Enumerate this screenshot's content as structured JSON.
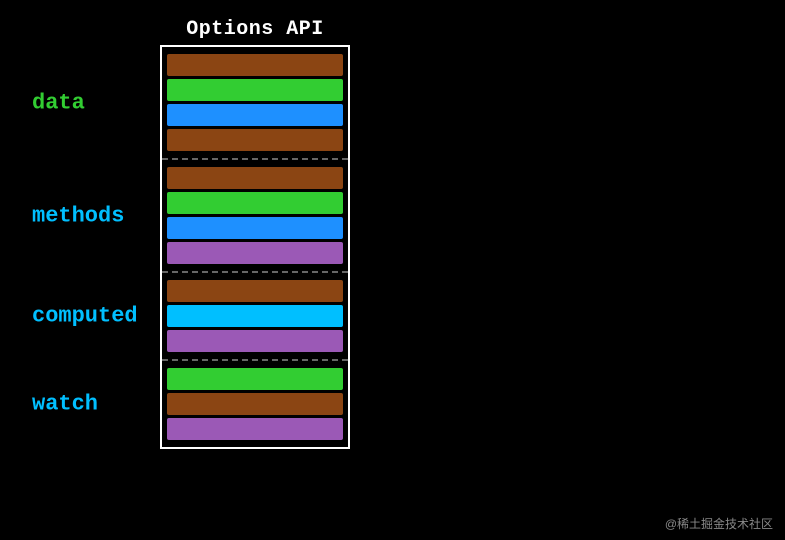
{
  "title": "Options API",
  "watermark": "@稀土掘金技术社区",
  "sections": [
    {
      "id": "data",
      "label": "data",
      "label_color": "#32CD32",
      "bars": [
        {
          "color": "brown"
        },
        {
          "color": "green"
        },
        {
          "color": "blue"
        },
        {
          "color": "brown"
        }
      ]
    },
    {
      "id": "methods",
      "label": "methods",
      "label_color": "#00BFFF",
      "bars": [
        {
          "color": "brown"
        },
        {
          "color": "green"
        },
        {
          "color": "blue"
        },
        {
          "color": "purple"
        }
      ]
    },
    {
      "id": "computed",
      "label": "computed",
      "label_color": "#00BFFF",
      "bars": [
        {
          "color": "brown"
        },
        {
          "color": "cyan"
        },
        {
          "color": "purple"
        }
      ]
    },
    {
      "id": "watch",
      "label": "watch",
      "label_color": "#00BFFF",
      "bars": [
        {
          "color": "green"
        },
        {
          "color": "brown"
        },
        {
          "color": "purple"
        }
      ]
    }
  ]
}
